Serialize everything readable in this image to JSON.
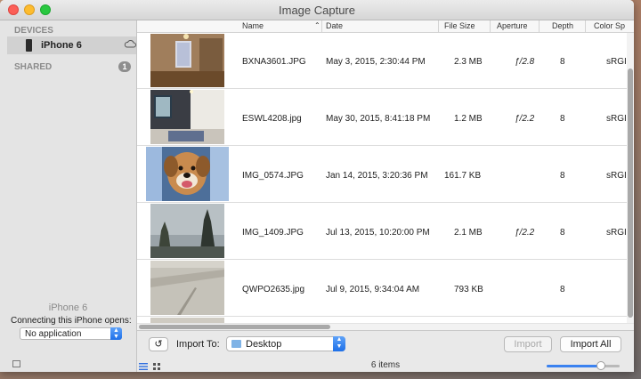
{
  "window": {
    "title": "Image Capture"
  },
  "sidebar": {
    "devices_header": "DEVICES",
    "device_name": "iPhone 6",
    "shared_header": "SHARED",
    "shared_count": "1",
    "footer_device": "iPhone 6",
    "connect_label": "Connecting this iPhone opens:",
    "connect_value": "No application"
  },
  "columns": {
    "name": "Name",
    "date": "Date",
    "file_size": "File Size",
    "aperture": "Aperture",
    "depth": "Depth",
    "color_space": "Color Sp"
  },
  "rows": [
    {
      "name": "BXNA3601.JPG",
      "date": "May 3, 2015, 2:30:44 PM",
      "size": "2.3 MB",
      "aperture": "ƒ/2.8",
      "depth": "8",
      "color": "sRGI",
      "thumb": "room-brown"
    },
    {
      "name": "ESWL4208.jpg",
      "date": "May 30, 2015, 8:41:18 PM",
      "size": "1.2 MB",
      "aperture": "ƒ/2.2",
      "depth": "8",
      "color": "sRGI",
      "thumb": "room-dark"
    },
    {
      "name": "IMG_0574.JPG",
      "date": "Jan 14, 2015, 3:20:36 PM",
      "size": "161.7 KB",
      "aperture": "",
      "depth": "8",
      "color": "sRGI",
      "thumb": "dog"
    },
    {
      "name": "IMG_1409.JPG",
      "date": "Jul 13, 2015, 10:20:00 PM",
      "size": "2.1 MB",
      "aperture": "ƒ/2.2",
      "depth": "8",
      "color": "sRGI",
      "thumb": "trees"
    },
    {
      "name": "QWPO2635.jpg",
      "date": "Jul 9, 2015, 9:34:04 AM",
      "size": "793 KB",
      "aperture": "",
      "depth": "8",
      "color": "",
      "thumb": "concrete"
    }
  ],
  "bottom": {
    "import_to_label": "Import To:",
    "destination": "Desktop",
    "import_button": "Import",
    "import_all_button": "Import All",
    "items_count": "6 items",
    "zoom_level": 0.78
  },
  "colors": {
    "accent": "#1e6fe8",
    "selection": "#d1d1d1"
  }
}
